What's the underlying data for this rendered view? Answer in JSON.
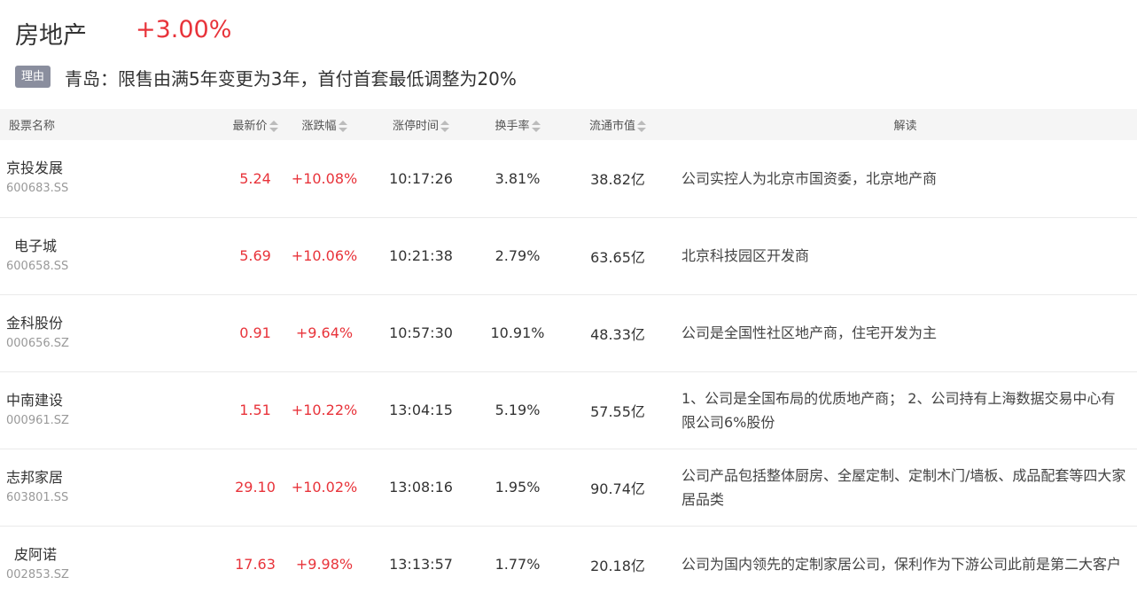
{
  "sector": {
    "name": "房地产",
    "change": "+3.00%"
  },
  "reason": {
    "badge": "理由",
    "text": "青岛：限售由满5年变更为3年，首付首套最低调整为20%"
  },
  "columns": {
    "name": "股票名称",
    "price": "最新价",
    "change": "涨跌幅",
    "limit_time": "涨停时间",
    "turnover": "换手率",
    "market_cap": "流通市值",
    "reading": "解读"
  },
  "rows": [
    {
      "name": "京投发展",
      "code": "600683.SS",
      "price": "5.24",
      "change": "+10.08%",
      "limit_time": "10:17:26",
      "turnover": "3.81%",
      "market_cap": "38.82亿",
      "reading": "公司实控人为北京市国资委，北京地产商"
    },
    {
      "name": "电子城",
      "code": "600658.SS",
      "price": "5.69",
      "change": "+10.06%",
      "limit_time": "10:21:38",
      "turnover": "2.79%",
      "market_cap": "63.65亿",
      "reading": "北京科技园区开发商"
    },
    {
      "name": "金科股份",
      "code": "000656.SZ",
      "price": "0.91",
      "change": "+9.64%",
      "limit_time": "10:57:30",
      "turnover": "10.91%",
      "market_cap": "48.33亿",
      "reading": "公司是全国性社区地产商，住宅开发为主"
    },
    {
      "name": "中南建设",
      "code": "000961.SZ",
      "price": "1.51",
      "change": "+10.22%",
      "limit_time": "13:04:15",
      "turnover": "5.19%",
      "market_cap": "57.55亿",
      "reading": "1、公司是全国布局的优质地产商； 2、公司持有上海数据交易中心有限公司6%股份"
    },
    {
      "name": "志邦家居",
      "code": "603801.SS",
      "price": "29.10",
      "change": "+10.02%",
      "limit_time": "13:08:16",
      "turnover": "1.95%",
      "market_cap": "90.74亿",
      "reading": "公司产品包括整体厨房、全屋定制、定制木门/墙板、成品配套等四大家居品类"
    },
    {
      "name": "皮阿诺",
      "code": "002853.SZ",
      "price": "17.63",
      "change": "+9.98%",
      "limit_time": "13:13:57",
      "turnover": "1.77%",
      "market_cap": "20.18亿",
      "reading": "公司为国内领先的定制家居公司，保利作为下游公司此前是第二大客户"
    }
  ],
  "colors": {
    "up": "#e8333a",
    "badge": "#8a8e9e",
    "header_bg": "#f5f5f5"
  }
}
